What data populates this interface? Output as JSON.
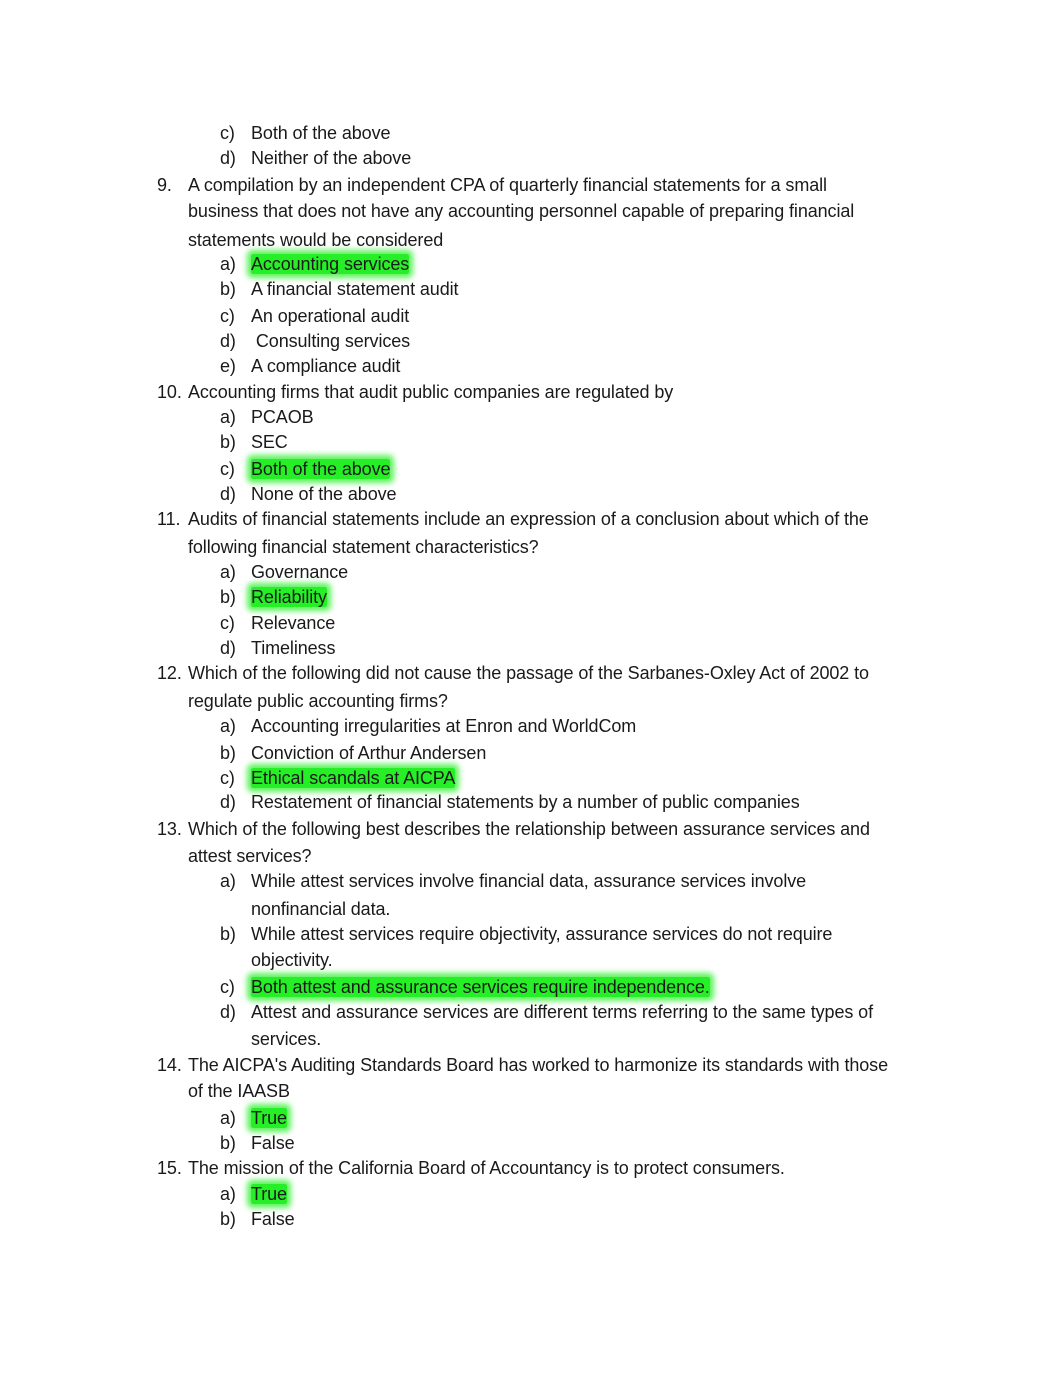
{
  "document": {
    "continued_options": [
      {
        "marker": "c)",
        "text": "Both of the above",
        "correct": false
      },
      {
        "marker": "d)",
        "text": "Neither of the above",
        "correct": false
      }
    ],
    "questions": [
      {
        "number": "9.",
        "lines": [
          "A compilation by an independent CPA of quarterly financial statements for a small",
          "business that does not have any accounting personnel capable of preparing financial",
          "statements would be considered"
        ],
        "options": [
          {
            "marker": "a)",
            "lines": [
              "Accounting services"
            ],
            "correct": true
          },
          {
            "marker": "b)",
            "lines": [
              "A financial statement audit"
            ],
            "correct": false
          },
          {
            "marker": "c)",
            "lines": [
              "An operational audit"
            ],
            "correct": false
          },
          {
            "marker": "d)",
            "lines": [
              " Consulting services"
            ],
            "correct": false
          },
          {
            "marker": "e)",
            "lines": [
              "A compliance audit"
            ],
            "correct": false
          }
        ]
      },
      {
        "number": "10.",
        "lines": [
          "Accounting firms that audit public companies are regulated by"
        ],
        "options": [
          {
            "marker": "a)",
            "lines": [
              "PCAOB"
            ],
            "correct": false
          },
          {
            "marker": "b)",
            "lines": [
              "SEC"
            ],
            "correct": false
          },
          {
            "marker": "c)",
            "lines": [
              "Both of the above"
            ],
            "correct": true
          },
          {
            "marker": "d)",
            "lines": [
              "None of the above"
            ],
            "correct": false
          }
        ]
      },
      {
        "number": "11.",
        "lines": [
          "Audits of financial statements include an expression of a conclusion about which of the",
          "following financial statement characteristics?"
        ],
        "options": [
          {
            "marker": "a)",
            "lines": [
              "Governance"
            ],
            "correct": false
          },
          {
            "marker": "b)",
            "lines": [
              "Reliability"
            ],
            "correct": true
          },
          {
            "marker": "c)",
            "lines": [
              "Relevance"
            ],
            "correct": false
          },
          {
            "marker": "d)",
            "lines": [
              "Timeliness"
            ],
            "correct": false
          }
        ]
      },
      {
        "number": "12.",
        "lines": [
          "Which of the following did not cause the passage of the Sarbanes-Oxley Act of 2002 to",
          "regulate public accounting firms?"
        ],
        "options": [
          {
            "marker": "a)",
            "lines": [
              "Accounting irregularities at Enron and WorldCom"
            ],
            "correct": false
          },
          {
            "marker": "b)",
            "lines": [
              "Conviction of Arthur Andersen"
            ],
            "correct": false
          },
          {
            "marker": "c)",
            "lines": [
              "Ethical scandals at AICPA"
            ],
            "correct": true
          },
          {
            "marker": "d)",
            "lines": [
              "Restatement of financial statements by a number of public companies"
            ],
            "correct": false
          }
        ]
      },
      {
        "number": "13.",
        "lines": [
          "Which of the following best describes the relationship between assurance services and",
          "attest services?"
        ],
        "options": [
          {
            "marker": "a)",
            "lines": [
              "While attest services involve financial data, assurance services involve",
              "nonfinancial data."
            ],
            "correct": false
          },
          {
            "marker": "b)",
            "lines": [
              "While attest services require objectivity, assurance services do not require",
              "objectivity."
            ],
            "correct": false
          },
          {
            "marker": "c)",
            "lines": [
              "Both attest and assurance services require independence."
            ],
            "correct": true
          },
          {
            "marker": "d)",
            "lines": [
              "Attest and assurance services are different terms referring to the same types of",
              "services."
            ],
            "correct": false
          }
        ]
      },
      {
        "number": "14.",
        "lines": [
          "The AICPA's Auditing Standards Board has worked to harmonize its standards with those",
          "of the IAASB"
        ],
        "options": [
          {
            "marker": "a)",
            "lines": [
              "True"
            ],
            "correct": true
          },
          {
            "marker": "b)",
            "lines": [
              "False"
            ],
            "correct": false
          }
        ]
      },
      {
        "number": "15.",
        "lines": [
          "The mission of the California Board of Accountancy is to protect consumers."
        ],
        "options": [
          {
            "marker": "a)",
            "lines": [
              "True"
            ],
            "correct": true
          },
          {
            "marker": "b)",
            "lines": [
              "False"
            ],
            "correct": false
          }
        ]
      }
    ],
    "highlight_color": "#27ef27"
  }
}
